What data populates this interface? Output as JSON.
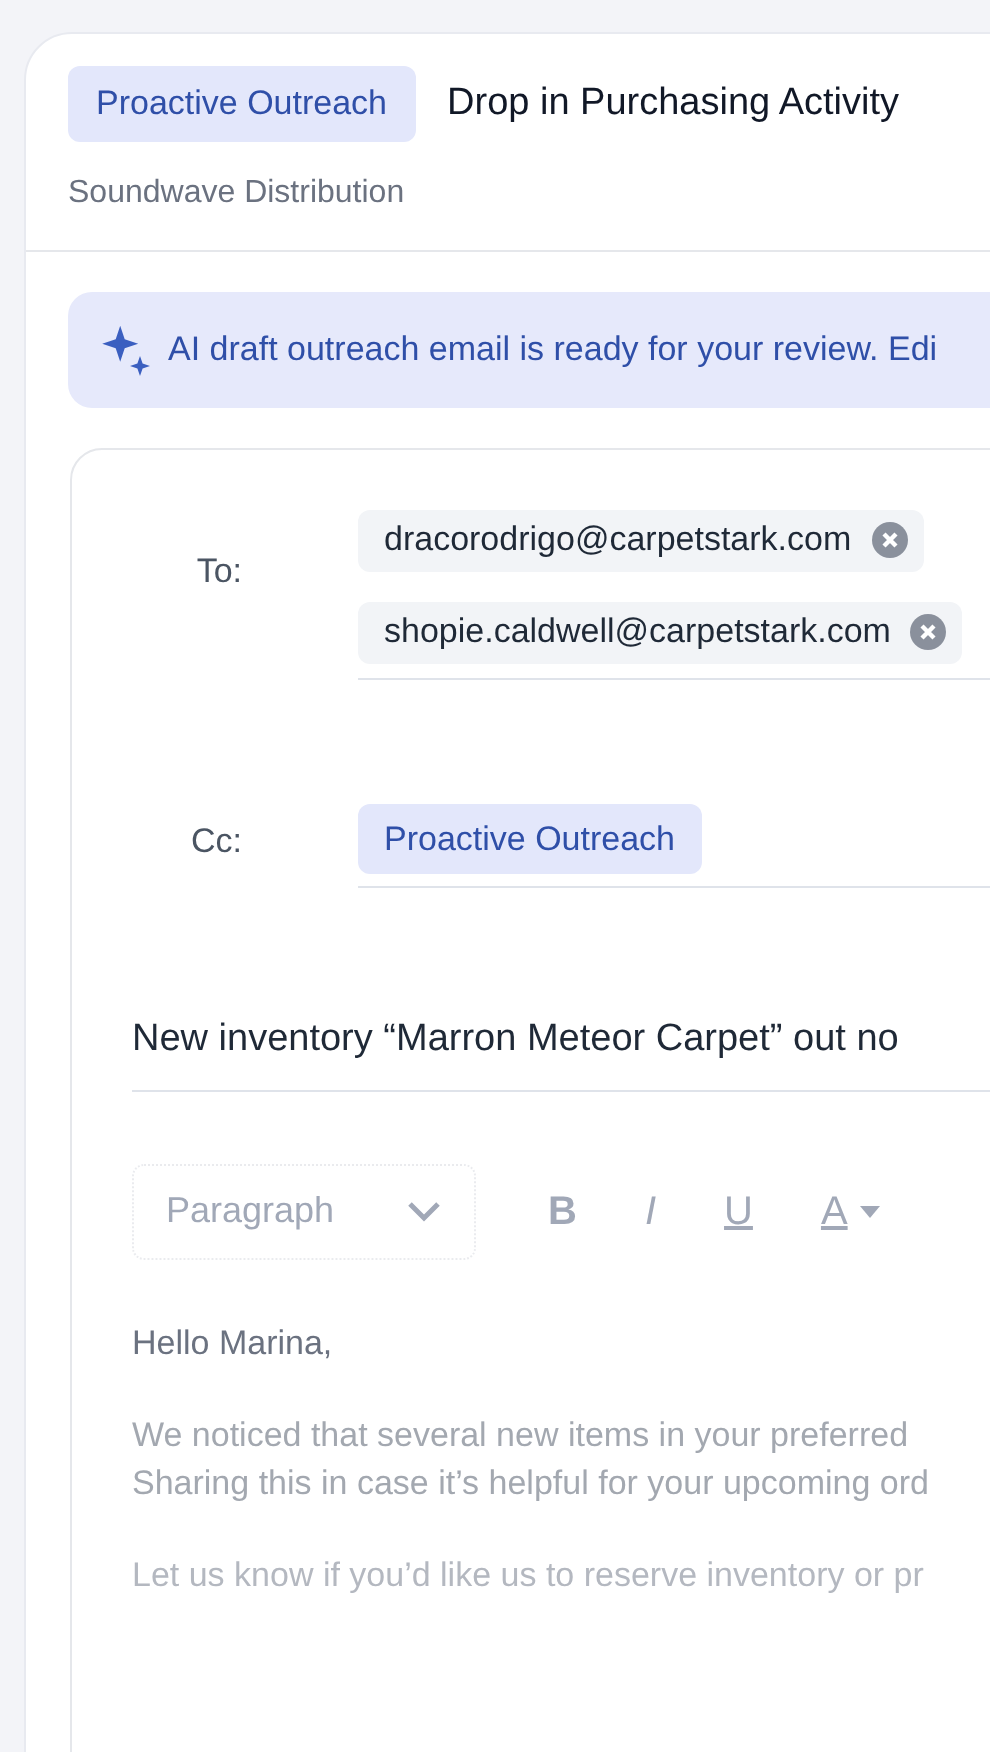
{
  "header": {
    "badge": "Proactive Outreach",
    "title": "Drop in Purchasing Activity",
    "subtitle": "Soundwave Distribution"
  },
  "banner": {
    "text": "AI draft outreach email is ready for your review. Edi"
  },
  "email": {
    "to_label": "To:",
    "to": [
      {
        "address": "dracorodrigo@carpetstark.com"
      },
      {
        "address": "shopie.caldwell@carpetstark.com"
      }
    ],
    "cc_label": "Cc:",
    "cc": [
      {
        "label": "Proactive Outreach"
      }
    ],
    "subject": "New inventory “Marron Meteor Carpet” out no",
    "toolbar": {
      "block_format": "Paragraph",
      "buttons": [
        {
          "kind": "bold",
          "label": "B"
        },
        {
          "kind": "italic",
          "label": "I"
        },
        {
          "kind": "underline",
          "label": "U"
        },
        {
          "kind": "color",
          "label": "A"
        }
      ]
    },
    "body": [
      {
        "lines": [
          "Hello Marina,"
        ]
      },
      {
        "lines": [
          "We noticed that several new items in your preferred",
          "Sharing this in case it’s helpful for your upcoming ord"
        ]
      },
      {
        "lines": [
          "Let us know if you’d like us to reserve inventory or pr"
        ]
      }
    ]
  }
}
